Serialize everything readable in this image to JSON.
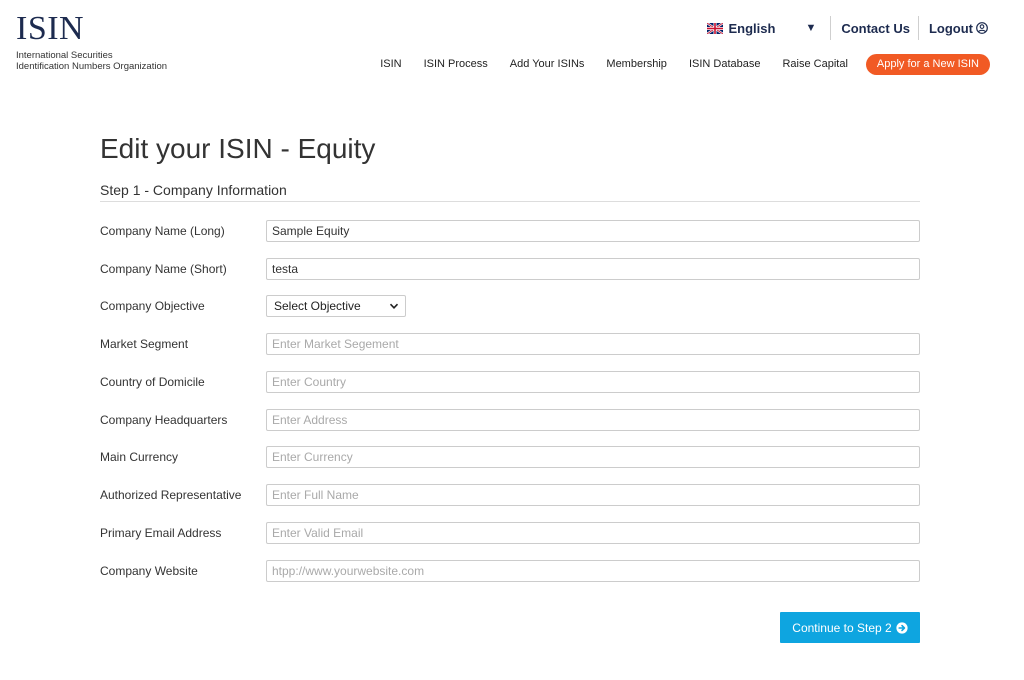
{
  "brand": {
    "logo_text": "ISIN",
    "subtitle_line1": "International Securities",
    "subtitle_line2": "Identification Numbers Organization"
  },
  "topbar": {
    "language": "English",
    "language_flag_icon": "uk-flag-icon",
    "contact": "Contact Us",
    "logout": "Logout"
  },
  "nav": {
    "items": [
      "ISIN",
      "ISIN Process",
      "Add Your ISINs",
      "Membership",
      "ISIN Database",
      "Raise Capital"
    ],
    "cta": "Apply for a New ISIN",
    "cta_color": "#f15a24"
  },
  "form": {
    "title": "Edit your ISIN - Equity",
    "step_title": "Step 1 - Company Information",
    "fields": {
      "company_name_long": {
        "label": "Company Name (Long)",
        "value": "Sample Equity",
        "placeholder": ""
      },
      "company_name_short": {
        "label": "Company Name (Short)",
        "value": "testa",
        "placeholder": ""
      },
      "company_objective": {
        "label": "Company Objective",
        "selected": "Select Objective"
      },
      "market_segment": {
        "label": "Market Segment",
        "value": "",
        "placeholder": "Enter Market Segement"
      },
      "country_of_domicile": {
        "label": "Country of Domicile",
        "value": "",
        "placeholder": "Enter Country"
      },
      "company_headquarters": {
        "label": "Company Headquarters",
        "value": "",
        "placeholder": "Enter Address"
      },
      "main_currency": {
        "label": "Main Currency",
        "value": "",
        "placeholder": "Enter Currency"
      },
      "authorized_representative": {
        "label": "Authorized Representative",
        "value": "",
        "placeholder": "Enter Full Name"
      },
      "primary_email": {
        "label": "Primary Email Address",
        "value": "",
        "placeholder": "Enter Valid Email"
      },
      "company_website": {
        "label": "Company Website",
        "value": "",
        "placeholder": "htpp://www.yourwebsite.com"
      }
    },
    "continue_label": "Continue to Step 2",
    "continue_color": "#0ea5e0"
  }
}
